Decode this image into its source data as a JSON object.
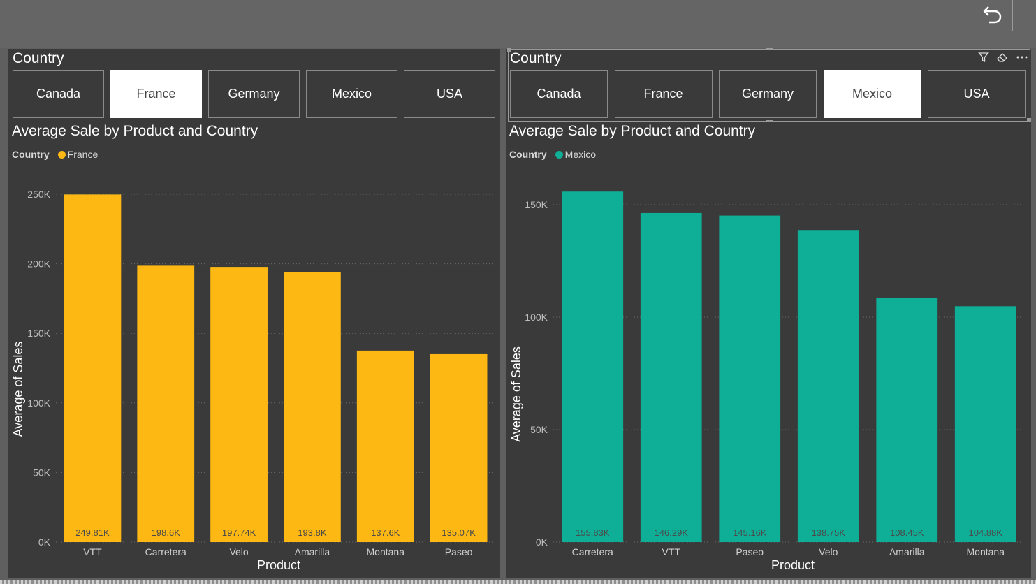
{
  "toolbar": {
    "undo_icon": "undo-arrow-icon"
  },
  "left": {
    "slicer_title": "Country",
    "slicer_options": [
      "Canada",
      "France",
      "Germany",
      "Mexico",
      "USA"
    ],
    "selected": "France",
    "chart_title": "Average Sale by Product and Country",
    "legend_title": "Country",
    "legend_item": "France",
    "color": "#FDB813"
  },
  "right": {
    "slicer_title": "Country",
    "slicer_options": [
      "Canada",
      "France",
      "Germany",
      "Mexico",
      "USA"
    ],
    "selected": "Mexico",
    "chart_title": "Average Sale by Product and Country",
    "legend_title": "Country",
    "legend_item": "Mexico",
    "color": "#0FAE96",
    "header_icons": [
      "filter-icon",
      "eraser-icon",
      "more-options-icon"
    ]
  },
  "chart_data": [
    {
      "type": "bar",
      "title": "Average Sale by Product and Country",
      "xlabel": "Product",
      "ylabel": "Average of Sales",
      "categories": [
        "VTT",
        "Carretera",
        "Velo",
        "Amarilla",
        "Montana",
        "Paseo"
      ],
      "series": [
        {
          "name": "France",
          "values": [
            249810,
            198600,
            197740,
            193800,
            137600,
            135070
          ]
        }
      ],
      "data_labels": [
        "249.81K",
        "198.6K",
        "197.74K",
        "193.8K",
        "137.6K",
        "135.07K"
      ],
      "ylim": [
        0,
        250000
      ],
      "yticks": [
        0,
        50000,
        100000,
        150000,
        200000,
        250000
      ],
      "ytick_labels": [
        "0K",
        "50K",
        "100K",
        "150K",
        "200K",
        "250K"
      ],
      "grid": true,
      "legend": "top-left"
    },
    {
      "type": "bar",
      "title": "Average Sale by Product and Country",
      "xlabel": "Product",
      "ylabel": "Average of Sales",
      "categories": [
        "Carretera",
        "VTT",
        "Paseo",
        "Velo",
        "Amarilla",
        "Montana"
      ],
      "series": [
        {
          "name": "Mexico",
          "values": [
            155830,
            146290,
            145160,
            138750,
            108450,
            104880
          ]
        }
      ],
      "data_labels": [
        "155.83K",
        "146.29K",
        "145.16K",
        "138.75K",
        "108.45K",
        "104.88K"
      ],
      "ylim": [
        0,
        150000
      ],
      "yticks": [
        0,
        50000,
        100000,
        150000
      ],
      "ytick_labels": [
        "0K",
        "50K",
        "100K",
        "150K"
      ],
      "grid": true,
      "legend": "top-left"
    }
  ]
}
